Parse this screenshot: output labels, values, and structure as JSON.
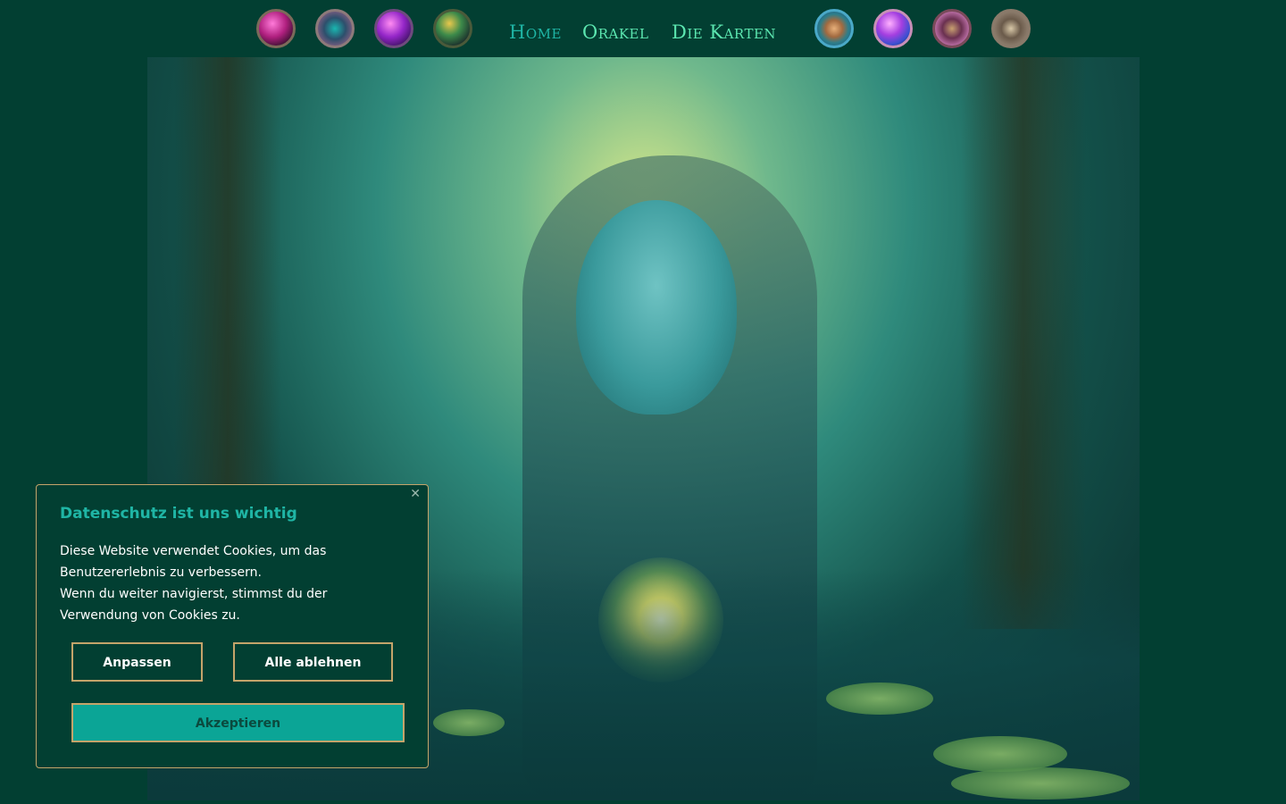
{
  "nav": {
    "links": [
      {
        "label": "Home"
      },
      {
        "label": "Orakel"
      },
      {
        "label": "Die Karten"
      }
    ],
    "left_icons": [
      "pink-orb-icon",
      "mandala-orb-icon",
      "purple-orb-icon",
      "green-orb-icon"
    ],
    "right_icons": [
      "bronze-flower-orb-icon",
      "violet-orb-icon",
      "mauve-orb-icon",
      "silver-ornament-orb-icon"
    ],
    "active": "Home",
    "colors": {
      "background": "#023f32",
      "link": "#5ce6b0",
      "active_link": "#1fb5a5"
    }
  },
  "hero": {
    "image_subject": "woman-in-swamp-image"
  },
  "cookie": {
    "close_icon": "close-icon",
    "title": "Datenschutz ist uns wichtig",
    "text_line1": "Diese Website verwendet Cookies, um das Benutzererlebnis zu verbessern.",
    "text_line2": "Wenn du weiter navigierst, stimmst du der Verwendung von Cookies zu.",
    "buttons": {
      "customize": "Anpassen",
      "reject": "Alle ablehnen",
      "accept": "Akzeptieren"
    },
    "colors": {
      "border": "#c4a46a",
      "accept_bg": "#0ba596",
      "title": "#1fb5a5"
    }
  }
}
